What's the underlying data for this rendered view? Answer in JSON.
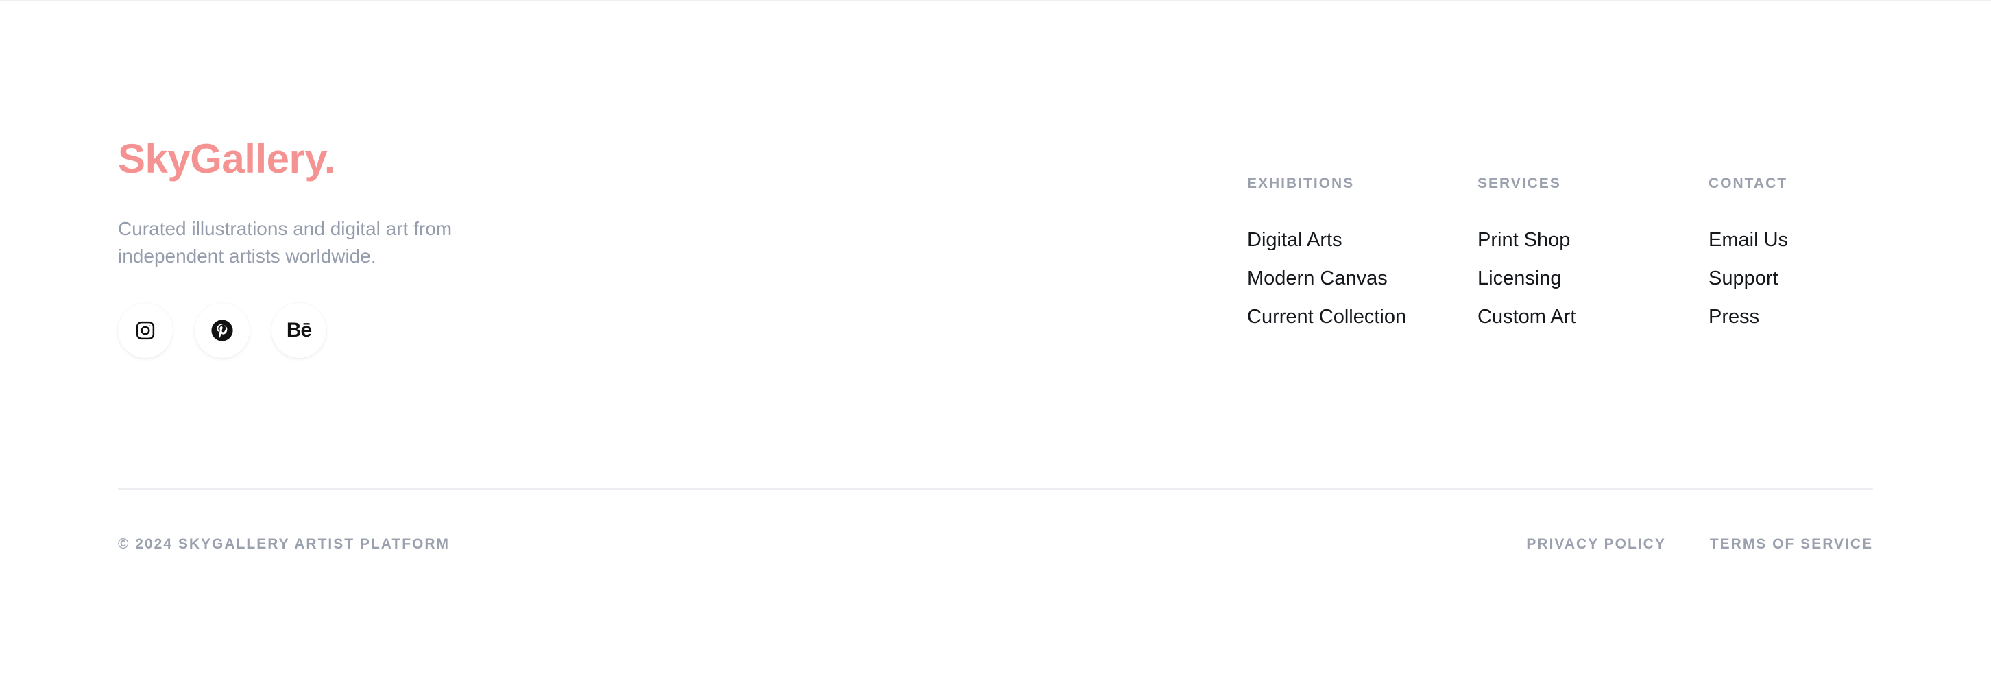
{
  "brand": {
    "name": "SkyGallery.",
    "color": "#f59393",
    "tagline_line1": "Curated illustrations and digital art from",
    "tagline_line2": "independent artists worldwide."
  },
  "social": [
    {
      "icon": "instagram-icon"
    },
    {
      "icon": "pinterest-icon"
    },
    {
      "icon": "behance-icon",
      "glyph": "Bē"
    }
  ],
  "columns": [
    {
      "heading": "EXHIBITIONS",
      "items": [
        "Digital Arts",
        "Modern Canvas",
        "Current Collection"
      ]
    },
    {
      "heading": "SERVICES",
      "items": [
        "Print Shop",
        "Licensing",
        "Custom Art"
      ]
    },
    {
      "heading": "CONTACT",
      "items": [
        "Email Us",
        "Support",
        "Press"
      ]
    }
  ],
  "bottom": {
    "copyright": "© 2024 SKYGALLERY ARTIST PLATFORM",
    "privacy": "PRIVACY POLICY",
    "terms": "TERMS OF SERVICE"
  }
}
